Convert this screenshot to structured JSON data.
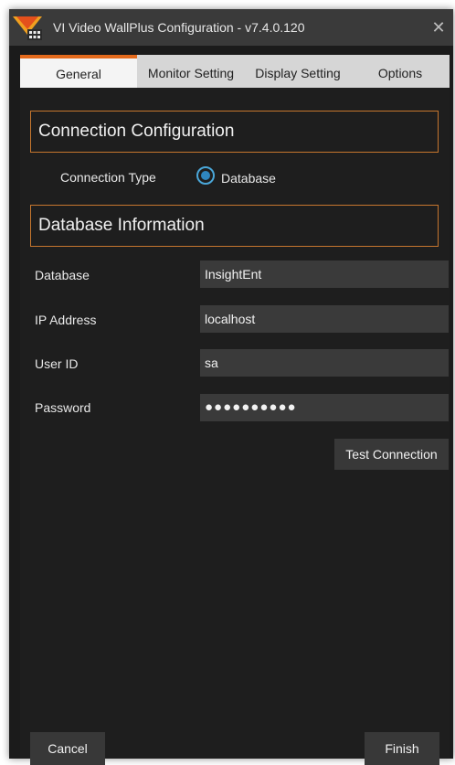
{
  "window": {
    "title": "VI Video WallPlus Configuration - v7.4.0.120",
    "close_glyph": "✕"
  },
  "tabs": [
    {
      "label": "General",
      "active": true
    },
    {
      "label": "Monitor Setting",
      "active": false
    },
    {
      "label": "Display Setting",
      "active": false
    },
    {
      "label": "Options",
      "active": false
    }
  ],
  "connection": {
    "section_title": "Connection Configuration",
    "type_label": "Connection Type",
    "type_option": "Database",
    "type_selected": true
  },
  "database": {
    "section_title": "Database Information",
    "fields": [
      {
        "label": "Database",
        "value": "InsightEnt"
      },
      {
        "label": "IP Address",
        "value": "localhost"
      },
      {
        "label": "User ID",
        "value": "sa"
      },
      {
        "label": "Password",
        "value": "●●●●●●●●●●"
      }
    ],
    "test_button": "Test Connection"
  },
  "footer": {
    "cancel": "Cancel",
    "finish": "Finish"
  },
  "colors": {
    "accent": "#e46a1c",
    "section_border": "#c6762e",
    "radio": "#2f86bf",
    "background": "#1e1e1e"
  }
}
